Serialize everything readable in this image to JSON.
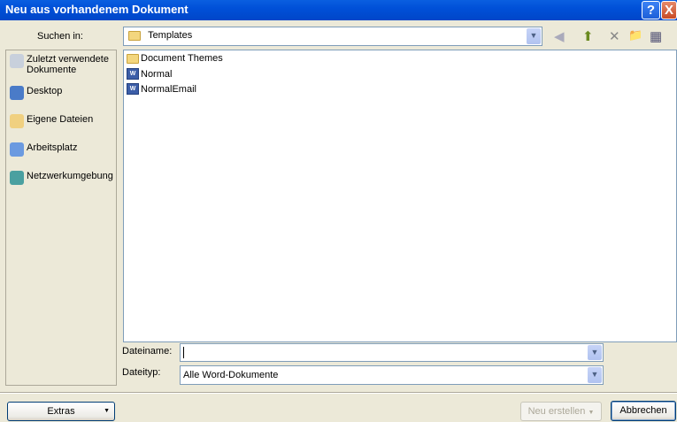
{
  "window": {
    "title": "Neu aus vorhandenem Dokument",
    "help": "?",
    "close": "X"
  },
  "lookin": {
    "label": "Suchen in:",
    "value": "Templates"
  },
  "toolbar": {
    "back": "◀",
    "up": "⬆",
    "delete": "✕",
    "new_folder": "📁",
    "views": "▦"
  },
  "places": [
    {
      "label": "Zuletzt verwendete Dokumente"
    },
    {
      "label": "Desktop"
    },
    {
      "label": "Eigene Dateien"
    },
    {
      "label": "Arbeitsplatz"
    },
    {
      "label": "Netzwerkumgebung"
    }
  ],
  "files": [
    {
      "name": "Document Themes",
      "type": "folder"
    },
    {
      "name": "Normal",
      "type": "word"
    },
    {
      "name": "NormalEmail",
      "type": "word"
    }
  ],
  "filename": {
    "label": "Dateiname:",
    "value": ""
  },
  "filetype": {
    "label": "Dateityp:",
    "value": "Alle Word-Dokumente"
  },
  "buttons": {
    "extras": "Extras",
    "create": "Neu erstellen",
    "cancel": "Abbrechen"
  }
}
